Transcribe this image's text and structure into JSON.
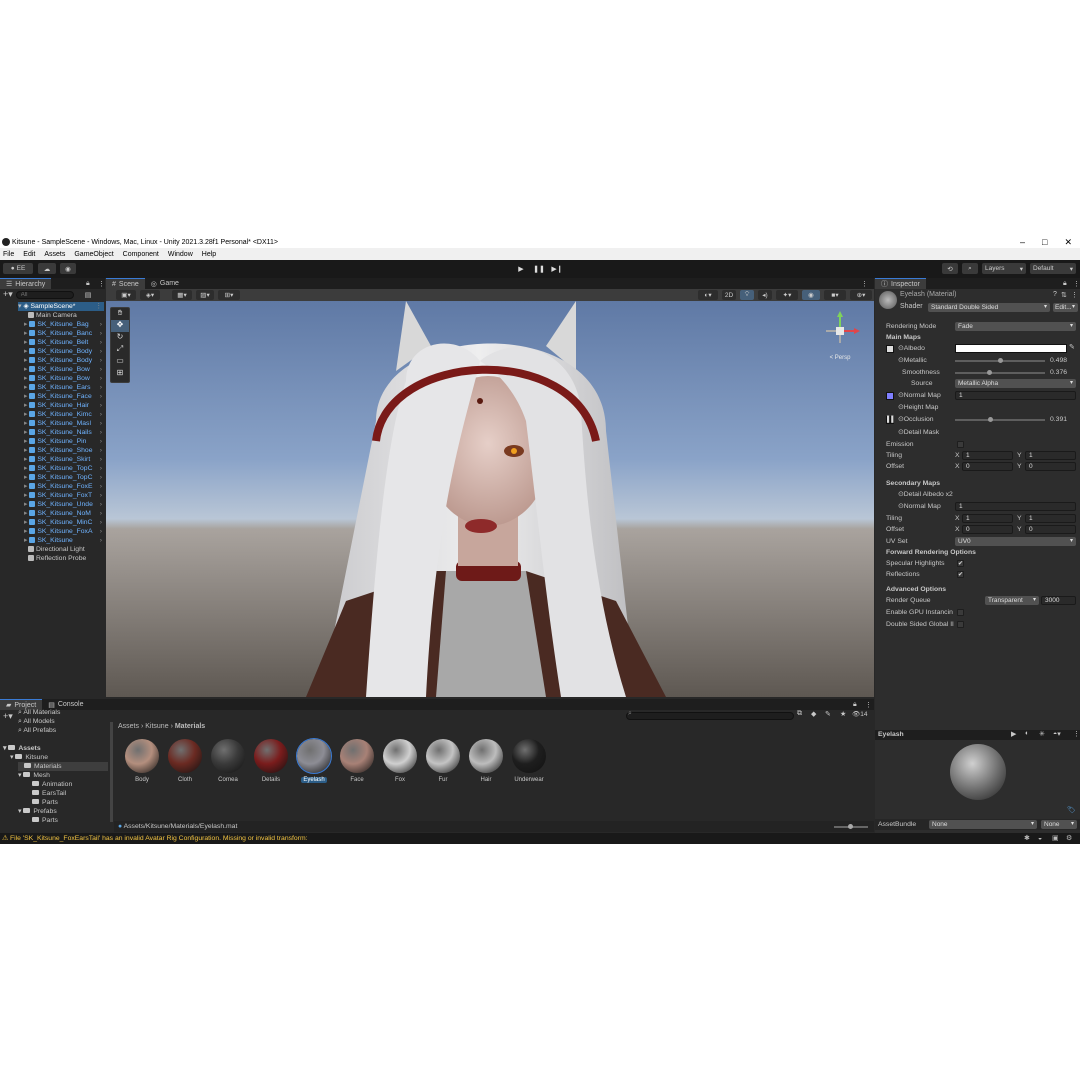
{
  "window": {
    "title": "Kitsune - SampleScene - Windows, Mac, Linux - Unity 2021.3.28f1 Personal* <DX11>",
    "controls": [
      "–",
      "□",
      "✕"
    ]
  },
  "menu": [
    "File",
    "Edit",
    "Assets",
    "GameObject",
    "Component",
    "Window",
    "Help"
  ],
  "toolbar": {
    "account": "EE",
    "layers": "Layers",
    "layout": "Default"
  },
  "hierarchy": {
    "tab": "Hierarchy",
    "search_placeholder": "All",
    "scene": "SampleScene*",
    "items": [
      "Main Camera",
      "SK_Kitsune_Bag",
      "SK_Kitsune_Banc",
      "SK_Kitsune_Belt",
      "SK_Kitsune_Body",
      "SK_Kitsune_Body",
      "SK_Kitsune_Bow",
      "SK_Kitsune_Bow",
      "SK_Kitsune_Ears",
      "SK_Kitsune_Face",
      "SK_Kitsune_Hair",
      "SK_Kitsune_Kimc",
      "SK_Kitsune_Masl",
      "SK_Kitsune_Nails",
      "SK_Kitsune_Pin",
      "SK_Kitsune_Shoe",
      "SK_Kitsune_Skirt",
      "SK_Kitsune_TopC",
      "SK_Kitsune_TopC",
      "SK_Kitsune_FoxE",
      "SK_Kitsune_FoxT",
      "SK_Kitsune_Unde",
      "SK_Kitsune_NoM",
      "SK_Kitsune_MinC",
      "SK_Kitsune_FoxA",
      "SK_Kitsune",
      "Directional Light",
      "Reflection Probe"
    ]
  },
  "scene": {
    "tabs": [
      "Scene",
      "Game"
    ],
    "mode_2d": "2D",
    "gizmo_label": "< Persp"
  },
  "inspector": {
    "tab": "Inspector",
    "material_name": "Eyelash (Material)",
    "shader_label": "Shader",
    "shader_value": "Standard Double Sided",
    "edit_label": "Edit...",
    "rendering_mode_label": "Rendering Mode",
    "rendering_mode_value": "Fade",
    "main_maps": "Main Maps",
    "albedo": "Albedo",
    "metallic": "Metallic",
    "metallic_value": "0.498",
    "smoothness": "Smoothness",
    "smoothness_value": "0.376",
    "source": "Source",
    "source_value": "Metallic Alpha",
    "normal_map": "Normal Map",
    "normal_map_value": "1",
    "height_map": "Height Map",
    "occlusion": "Occlusion",
    "occlusion_value": "0.391",
    "detail_mask": "Detail Mask",
    "emission": "Emission",
    "tiling": "Tiling",
    "offset": "Offset",
    "x": "X",
    "y": "Y",
    "tiling_x": "1",
    "tiling_y": "1",
    "offset_x": "0",
    "offset_y": "0",
    "secondary_maps": "Secondary Maps",
    "detail_albedo": "Detail Albedo x2",
    "normal_map2": "Normal Map",
    "normal_map2_value": "1",
    "tiling2_x": "1",
    "tiling2_y": "1",
    "offset2_x": "0",
    "offset2_y": "0",
    "uv_set": "UV Set",
    "uv_set_value": "UV0",
    "forward_options": "Forward Rendering Options",
    "specular_highlights": "Specular Highlights",
    "reflections": "Reflections",
    "advanced_options": "Advanced Options",
    "render_queue": "Render Queue",
    "render_queue_mode": "Transparent",
    "render_queue_value": "3000",
    "gpu_instancing": "Enable GPU Instancin",
    "double_sided_gi": "Double Sided Global Il",
    "preview_name": "Eyelash",
    "asset_bundle_label": "AssetBundle",
    "asset_bundle_value": "None",
    "asset_bundle_variant": "None",
    "colors": {
      "albedo": "#ffffff",
      "normal_swatch": "#7f7fff"
    }
  },
  "project": {
    "tabs": [
      "Project",
      "Console"
    ],
    "favorites": [
      "All Materials",
      "All Models",
      "All Prefabs"
    ],
    "tree": [
      "Assets",
      "Kitsune",
      "Materials",
      "Mesh",
      "Animation",
      "EarsTail",
      "Parts",
      "Prefabs",
      "Parts"
    ],
    "breadcrumb": [
      "Assets",
      "Kitsune",
      "Materials"
    ],
    "visible_count": "14",
    "materials": [
      {
        "name": "Body",
        "color": "#b48f7e"
      },
      {
        "name": "Cloth",
        "color": "#6b2a22"
      },
      {
        "name": "Cornea",
        "color": "#3a3a3a"
      },
      {
        "name": "Details",
        "color": "#7a1c1c"
      },
      {
        "name": "Eyelash",
        "color": "#8d8d95"
      },
      {
        "name": "Face",
        "color": "#a88176"
      },
      {
        "name": "Fox",
        "color": "#d0d0d0"
      },
      {
        "name": "Fur",
        "color": "#c4c4c4"
      },
      {
        "name": "Hair",
        "color": "#bdbdbd"
      },
      {
        "name": "Underwear",
        "color": "#1e1e1e"
      }
    ],
    "selected_path": "Assets/Kitsune/Materials/Eyelash.mat"
  },
  "status": {
    "message": "File 'SK_Kitsune_FoxEarsTail' has an invalid Avatar Rig Configuration. Missing or invalid transform:"
  }
}
